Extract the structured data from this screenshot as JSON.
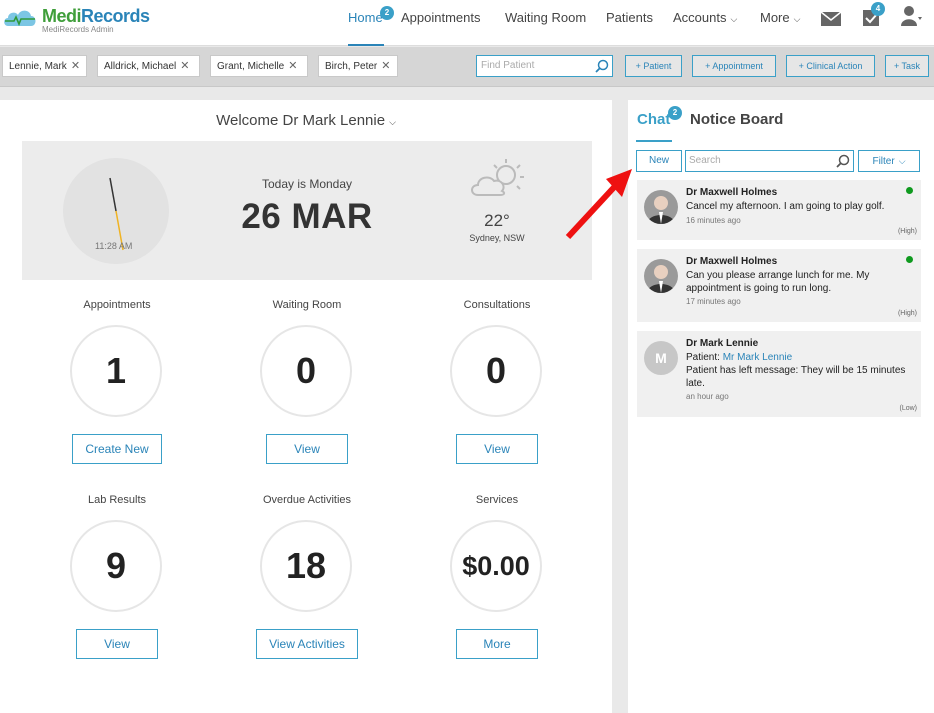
{
  "brand": {
    "name_part1": "Medi",
    "name_part2": "Records",
    "subtitle": "MediRecords Admin"
  },
  "nav": {
    "items": [
      {
        "label": "Home",
        "active": true,
        "badge": "2"
      },
      {
        "label": "Appointments"
      },
      {
        "label": "Waiting Room"
      },
      {
        "label": "Patients"
      },
      {
        "label": "Accounts",
        "dropdown": true
      },
      {
        "label": "More",
        "dropdown": true
      }
    ],
    "icons": {
      "mail": "mail-icon",
      "tasks": "tasks-icon",
      "user": "user-icon"
    },
    "tasks_badge": "4"
  },
  "patient_tabs": [
    "Lennie, Mark",
    "Alldrick, Michael",
    "Grant, Michelle",
    "Birch, Peter"
  ],
  "find_patient": {
    "placeholder": "Find Patient"
  },
  "quick_actions": [
    "+ Patient",
    "+ Appointment",
    "+ Clinical Action",
    "+ Task"
  ],
  "welcome": {
    "text": "Welcome Dr Mark Lennie"
  },
  "hero": {
    "clock_time": "11:28 AM",
    "today_label": "Today is Monday",
    "date": "26 MAR",
    "temperature": "22°",
    "location": "Sydney, NSW"
  },
  "stats": [
    {
      "label": "Appointments",
      "value": "1",
      "button": "Create New"
    },
    {
      "label": "Waiting Room",
      "value": "0",
      "button": "View"
    },
    {
      "label": "Consultations",
      "value": "0",
      "button": "View"
    },
    {
      "label": "Lab Results",
      "value": "9",
      "button": "View"
    },
    {
      "label": "Overdue Activities",
      "value": "18",
      "button": "View Activities"
    },
    {
      "label": "Services",
      "value": "$0.00",
      "button": "More"
    }
  ],
  "side": {
    "chat_tab": "Chat",
    "chat_badge": "2",
    "notice_tab": "Notice Board",
    "new_button": "New",
    "search_placeholder": "Search",
    "filter_button": "Filter",
    "messages": [
      {
        "sender": "Dr Maxwell Holmes",
        "text": "Cancel my afternoon. I am going to play golf.",
        "time": "16 minutes ago",
        "priority": "(High)",
        "online": true
      },
      {
        "sender": "Dr Maxwell Holmes",
        "text": "Can you please arrange lunch for me. My appointment is going to run long.",
        "time": "17 minutes ago",
        "priority": "(High)",
        "online": true
      },
      {
        "sender": "Dr Mark Lennie",
        "avatar_letter": "M",
        "patient_label": "Patient:",
        "patient_name": "Mr Mark Lennie",
        "text": "Patient has left message: They will be 15 minutes late.",
        "time": "an hour ago",
        "priority": "(Low)"
      }
    ]
  }
}
